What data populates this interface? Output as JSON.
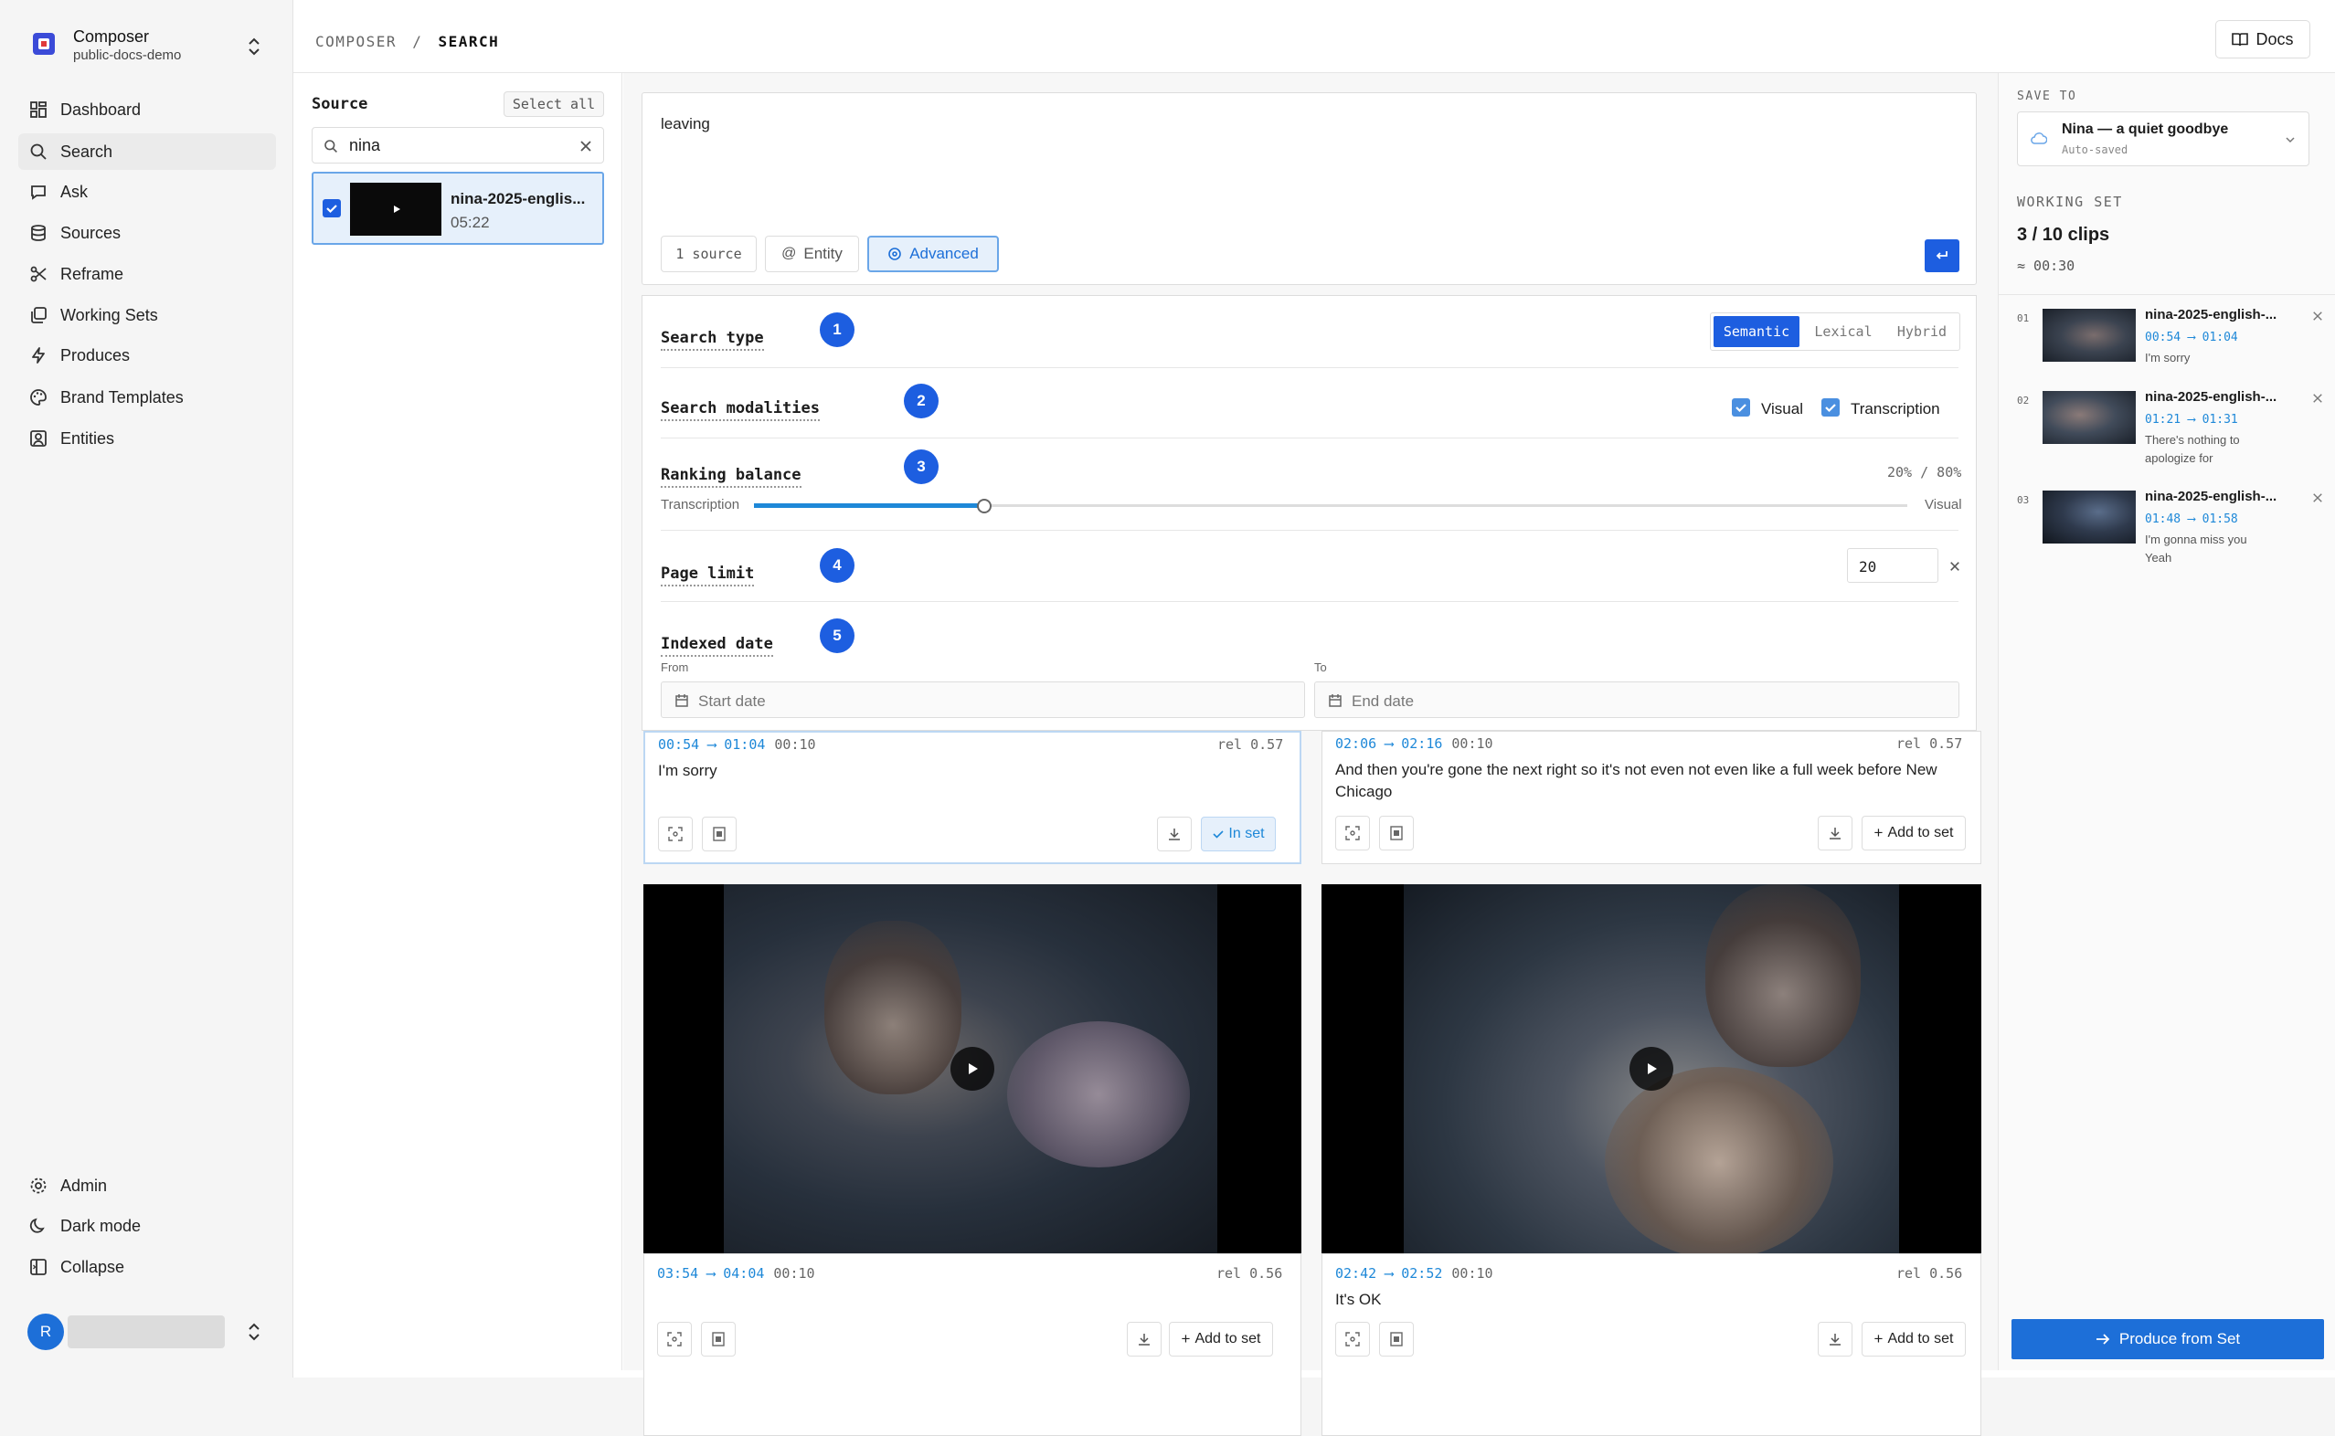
{
  "org": {
    "name": "Composer",
    "workspace": "public-docs-demo"
  },
  "nav": [
    {
      "label": "Dashboard",
      "icon": "grid-icon"
    },
    {
      "label": "Search",
      "icon": "search-icon"
    },
    {
      "label": "Ask",
      "icon": "chat-icon"
    },
    {
      "label": "Sources",
      "icon": "database-icon"
    },
    {
      "label": "Reframe",
      "icon": "scissors-icon"
    },
    {
      "label": "Working Sets",
      "icon": "stack-icon"
    },
    {
      "label": "Produces",
      "icon": "bolt-icon"
    },
    {
      "label": "Brand Templates",
      "icon": "palette-icon"
    },
    {
      "label": "Entities",
      "icon": "user-square-icon"
    }
  ],
  "nav_bottom": [
    {
      "label": "Admin",
      "icon": "gear-icon"
    },
    {
      "label": "Dark mode",
      "icon": "moon-icon"
    },
    {
      "label": "Collapse",
      "icon": "panel-icon"
    }
  ],
  "user": {
    "initial": "R"
  },
  "breadcrumb": {
    "root": "COMPOSER",
    "sep": "/",
    "current": "SEARCH"
  },
  "docs_label": "Docs",
  "source": {
    "title": "Source",
    "select_all": "Select all",
    "filter_value": "nina",
    "item": {
      "name": "nina-2025-englis...",
      "duration": "05:22",
      "checked": true
    }
  },
  "query": {
    "text": "leaving",
    "source_chip": "1 source",
    "entity_chip": "Entity",
    "advanced_chip": "Advanced",
    "submit_icon": "return-icon"
  },
  "options": {
    "search_type": {
      "label": "Search type",
      "badge": "1",
      "choices": [
        "Semantic",
        "Lexical",
        "Hybrid"
      ],
      "selected": "Semantic"
    },
    "modalities": {
      "label": "Search modalities",
      "badge": "2",
      "visual": "Visual",
      "transcription": "Transcription",
      "visual_checked": true,
      "transcription_checked": true
    },
    "ranking": {
      "label": "Ranking balance",
      "badge": "3",
      "ratio": "20% / 80%",
      "left": "Transcription",
      "right": "Visual",
      "value": 0.2
    },
    "page_limit": {
      "label": "Page limit",
      "badge": "4",
      "value": "20"
    },
    "indexed_date": {
      "label": "Indexed date",
      "badge": "5",
      "from_label": "From",
      "to_label": "To",
      "from_placeholder": "Start date",
      "to_placeholder": "End date"
    }
  },
  "results": [
    {
      "start": "00:54",
      "end": "01:04",
      "dur": "00:10",
      "rel": "rel 0.57",
      "text": "I'm sorry",
      "action": "In set",
      "in_set": true
    },
    {
      "start": "02:06",
      "end": "02:16",
      "dur": "00:10",
      "rel": "rel 0.57",
      "text": "And then you're gone the next right so it's not even not even like a full week before New Chicago",
      "action": "Add to set",
      "in_set": false
    },
    {
      "start": "03:54",
      "end": "04:04",
      "dur": "00:10",
      "rel": "rel 0.56",
      "text": "",
      "action": "Add to set",
      "in_set": false
    },
    {
      "start": "02:42",
      "end": "02:52",
      "dur": "00:10",
      "rel": "rel 0.56",
      "text": "It's OK",
      "action": "Add to set",
      "in_set": false
    }
  ],
  "arrow": "⟶",
  "save_to": {
    "label": "SAVE TO",
    "set_name": "Nina — a quiet goodbye",
    "status": "Auto-saved"
  },
  "working_set": {
    "label": "WORKING SET",
    "count": "3 / 10 clips",
    "duration": "≈ 00:30",
    "items": [
      {
        "num": "01",
        "name": "nina-2025-english-...",
        "start": "00:54",
        "end": "01:04",
        "line1": "I'm sorry",
        "line2": ""
      },
      {
        "num": "02",
        "name": "nina-2025-english-...",
        "start": "01:21",
        "end": "01:31",
        "line1": "There's nothing to",
        "line2": "apologize for"
      },
      {
        "num": "03",
        "name": "nina-2025-english-...",
        "start": "01:48",
        "end": "01:58",
        "line1": "I'm gonna miss you",
        "line2": "Yeah"
      }
    ]
  },
  "produce_label": "Produce from Set",
  "colors": {
    "accent": "#1d5ee0",
    "time": "#1e88d8",
    "selected_bg": "#e6f0fb"
  }
}
